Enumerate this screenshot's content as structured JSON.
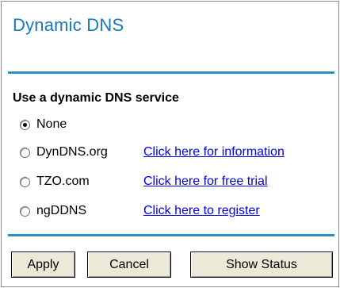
{
  "title": "Dynamic DNS",
  "section_label": "Use a dynamic DNS service",
  "options": [
    {
      "label": "None",
      "checked": true,
      "link": ""
    },
    {
      "label": "DynDNS.org",
      "checked": false,
      "link": "Click here for information"
    },
    {
      "label": "TZO.com",
      "checked": false,
      "link": "Click here for free trial"
    },
    {
      "label": "ngDDNS",
      "checked": false,
      "link": "Click here to register"
    }
  ],
  "buttons": {
    "apply": "Apply",
    "cancel": "Cancel",
    "show_status": "Show Status"
  },
  "colors": {
    "title": "#1a78b4",
    "rule": "#2a8fc8",
    "link": "#0000ee"
  }
}
